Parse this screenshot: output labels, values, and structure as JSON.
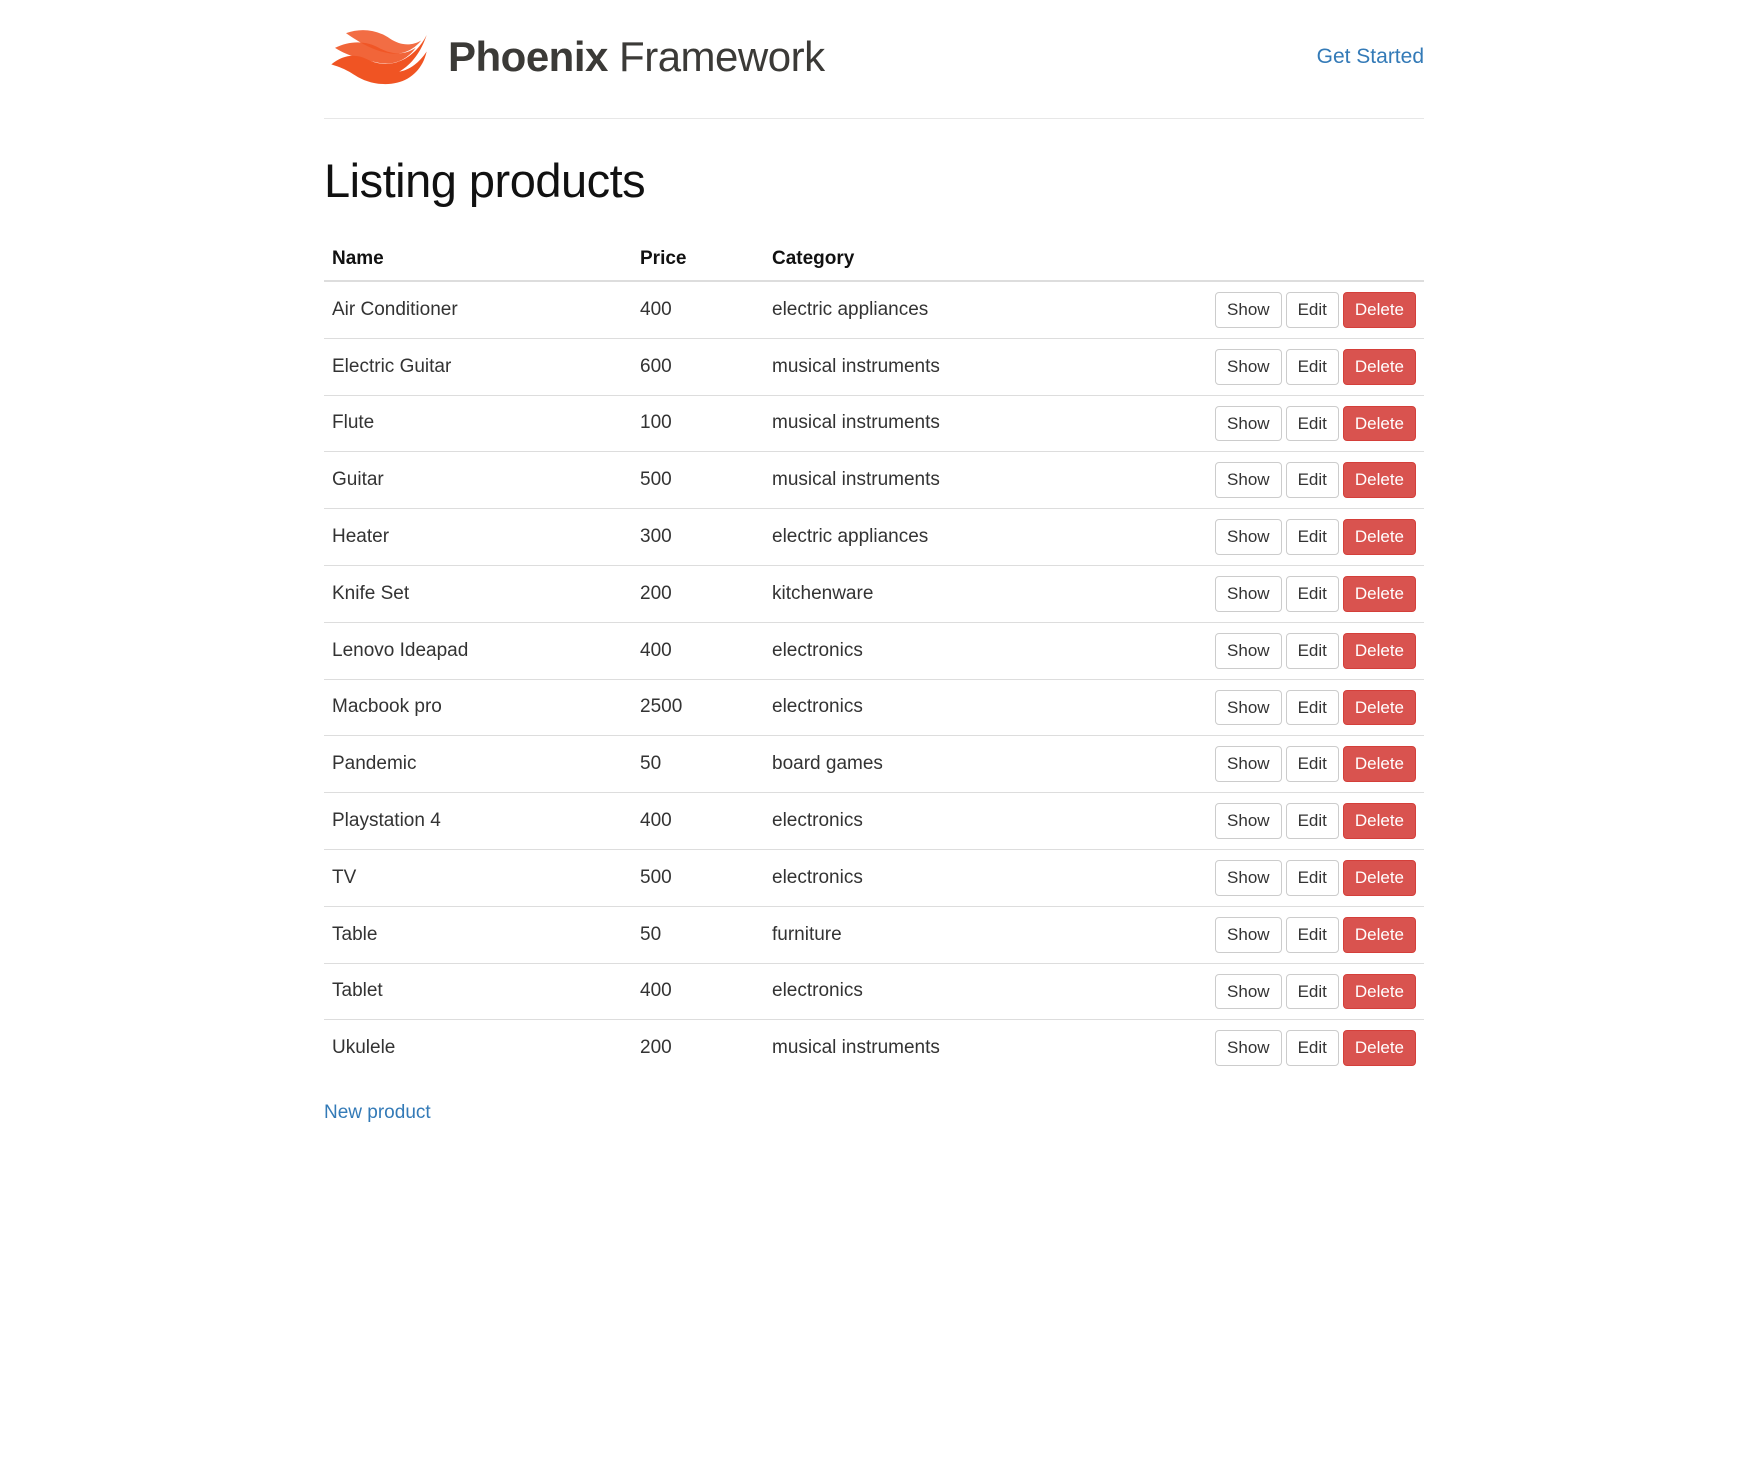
{
  "header": {
    "brand_strong": "Phoenix",
    "brand_light": "Framework",
    "nav_link": "Get Started"
  },
  "page": {
    "title": "Listing products",
    "new_link": "New product"
  },
  "table": {
    "headers": {
      "name": "Name",
      "price": "Price",
      "category": "Category"
    },
    "actions": {
      "show": "Show",
      "edit": "Edit",
      "delete": "Delete"
    },
    "rows": [
      {
        "name": "Air Conditioner",
        "price": "400",
        "category": "electric appliances"
      },
      {
        "name": "Electric Guitar",
        "price": "600",
        "category": "musical instruments"
      },
      {
        "name": "Flute",
        "price": "100",
        "category": "musical instruments"
      },
      {
        "name": "Guitar",
        "price": "500",
        "category": "musical instruments"
      },
      {
        "name": "Heater",
        "price": "300",
        "category": "electric appliances"
      },
      {
        "name": "Knife Set",
        "price": "200",
        "category": "kitchenware"
      },
      {
        "name": "Lenovo Ideapad",
        "price": "400",
        "category": "electronics"
      },
      {
        "name": "Macbook pro",
        "price": "2500",
        "category": "electronics"
      },
      {
        "name": "Pandemic",
        "price": "50",
        "category": "board games"
      },
      {
        "name": "Playstation 4",
        "price": "400",
        "category": "electronics"
      },
      {
        "name": "TV",
        "price": "500",
        "category": "electronics"
      },
      {
        "name": "Table",
        "price": "50",
        "category": "furniture"
      },
      {
        "name": "Tablet",
        "price": "400",
        "category": "electronics"
      },
      {
        "name": "Ukulele",
        "price": "200",
        "category": "musical instruments"
      }
    ]
  }
}
